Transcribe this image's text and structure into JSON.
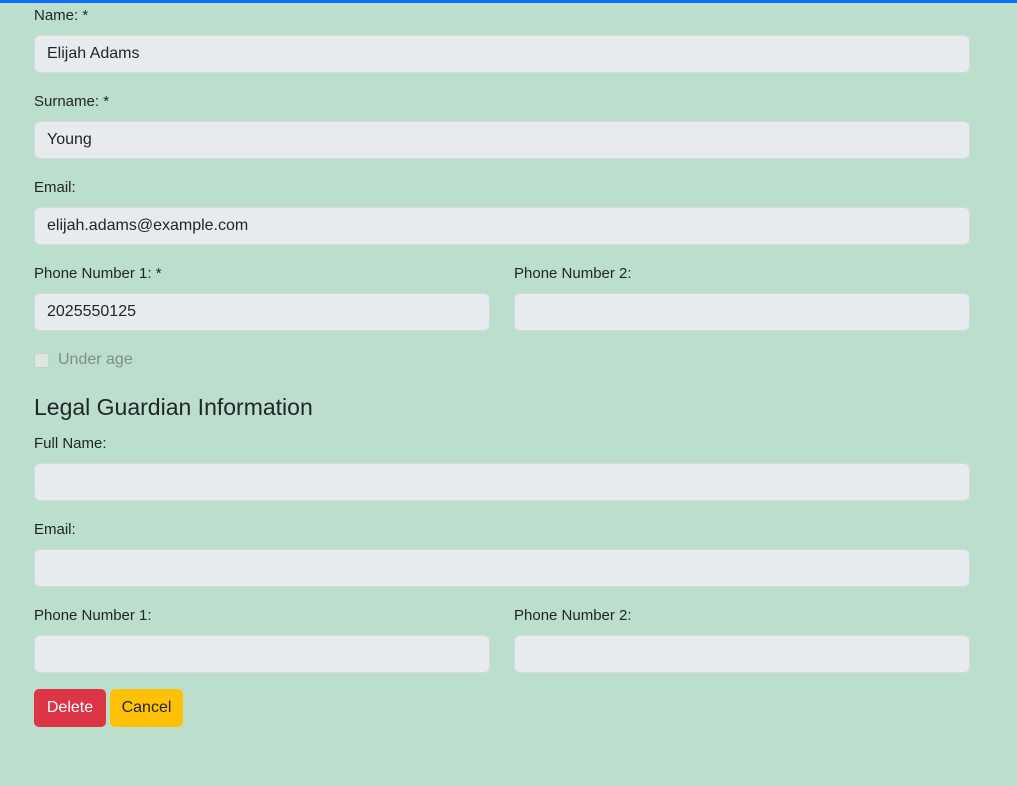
{
  "person": {
    "name_label": "Name: *",
    "name_value": "Elijah Adams",
    "surname_label": "Surname: *",
    "surname_value": "Young",
    "email_label": "Email:",
    "email_value": "elijah.adams@example.com",
    "phone1_label": "Phone Number 1: *",
    "phone1_value": "2025550125",
    "phone2_label": "Phone Number 2:",
    "phone2_value": ""
  },
  "under_age": {
    "label": "Under age",
    "checked": false
  },
  "guardian": {
    "section_title": "Legal Guardian Information",
    "full_name_label": "Full Name:",
    "full_name_value": "",
    "email_label": "Email:",
    "email_value": "",
    "phone1_label": "Phone Number 1:",
    "phone1_value": "",
    "phone2_label": "Phone Number 2:",
    "phone2_value": ""
  },
  "actions": {
    "delete_label": "Delete",
    "cancel_label": "Cancel"
  },
  "colors": {
    "background": "#bcdecd",
    "top_bar": "#0d6efd",
    "delete_button": "#dc3545",
    "cancel_button": "#ffc107",
    "input_background": "#e8ebee"
  }
}
